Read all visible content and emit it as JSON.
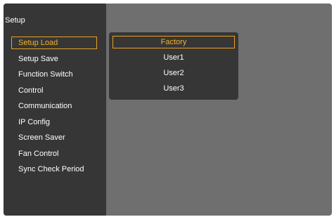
{
  "panel": {
    "title": "Setup"
  },
  "menu": {
    "items": [
      {
        "label": "Setup Load",
        "selected": true
      },
      {
        "label": "Setup Save",
        "selected": false
      },
      {
        "label": "Function Switch",
        "selected": false
      },
      {
        "label": "Control",
        "selected": false
      },
      {
        "label": "Communication",
        "selected": false
      },
      {
        "label": "IP Config",
        "selected": false
      },
      {
        "label": "Screen Saver",
        "selected": false
      },
      {
        "label": "Fan Control",
        "selected": false
      },
      {
        "label": "Sync Check Period",
        "selected": false
      }
    ]
  },
  "submenu": {
    "items": [
      {
        "label": "Factory",
        "selected": true
      },
      {
        "label": "User1",
        "selected": false
      },
      {
        "label": "User2",
        "selected": false
      },
      {
        "label": "User3",
        "selected": false
      }
    ]
  },
  "colors": {
    "background": "#6f6f6f",
    "panel": "#363636",
    "text": "#ffffff",
    "highlight": "#f5b228",
    "highlight_border": "#e8a022"
  }
}
